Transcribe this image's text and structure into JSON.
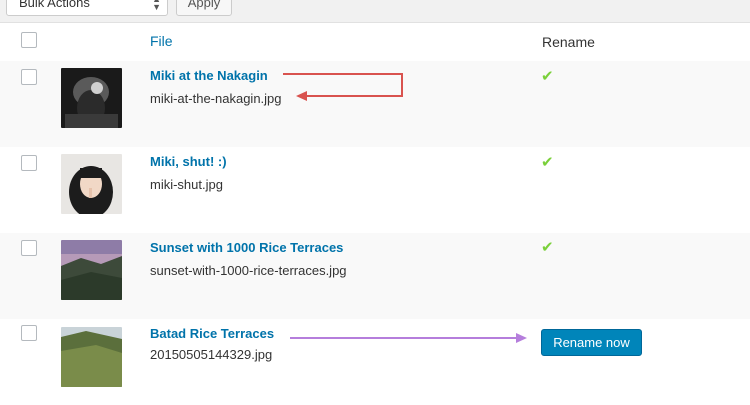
{
  "toolbar": {
    "bulk_actions": "Bulk Actions",
    "apply": "Apply"
  },
  "table": {
    "headers": {
      "file": "File",
      "rename": "Rename"
    },
    "rows": [
      {
        "title": "Miki at the Nakagin",
        "filename": "miki-at-the-nakagin.jpg",
        "status": "renamed",
        "status_icon": "checkmark-icon"
      },
      {
        "title": "Miki, shut! :)",
        "filename": "miki-shut.jpg",
        "status": "renamed",
        "status_icon": "checkmark-icon"
      },
      {
        "title": "Sunset with 1000 Rice Terraces",
        "filename": "sunset-with-1000-rice-terraces.jpg",
        "status": "renamed",
        "status_icon": "checkmark-icon"
      },
      {
        "title": "Batad Rice Terraces",
        "filename": "20150505144329.jpg",
        "status": "pending",
        "button_label": "Rename now"
      }
    ]
  },
  "colors": {
    "link": "#0073aa",
    "check": "#7ad03a",
    "primary_button": "#0085ba",
    "red_arrow": "#d9534f",
    "purple_arrow": "#b57edc"
  }
}
